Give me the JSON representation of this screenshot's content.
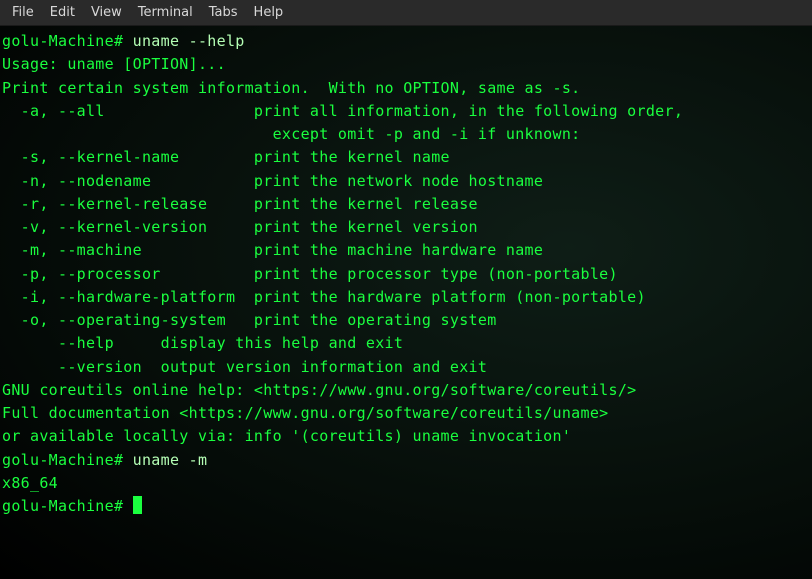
{
  "menubar": {
    "items": [
      "File",
      "Edit",
      "View",
      "Terminal",
      "Tabs",
      "Help"
    ]
  },
  "terminal": {
    "prompt": "golu-Machine#",
    "entries": [
      {
        "cmd": "uname --help",
        "output": [
          "Usage: uname [OPTION]...",
          "Print certain system information.  With no OPTION, same as -s.",
          "",
          "  -a, --all                print all information, in the following order,",
          "                             except omit -p and -i if unknown:",
          "  -s, --kernel-name        print the kernel name",
          "  -n, --nodename           print the network node hostname",
          "  -r, --kernel-release     print the kernel release",
          "  -v, --kernel-version     print the kernel version",
          "  -m, --machine            print the machine hardware name",
          "  -p, --processor          print the processor type (non-portable)",
          "  -i, --hardware-platform  print the hardware platform (non-portable)",
          "  -o, --operating-system   print the operating system",
          "      --help     display this help and exit",
          "      --version  output version information and exit",
          "",
          "GNU coreutils online help: <https://www.gnu.org/software/coreutils/>",
          "Full documentation <https://www.gnu.org/software/coreutils/uname>",
          "or available locally via: info '(coreutils) uname invocation'"
        ]
      },
      {
        "cmd": "uname -m",
        "output": [
          "x86_64"
        ]
      }
    ]
  }
}
